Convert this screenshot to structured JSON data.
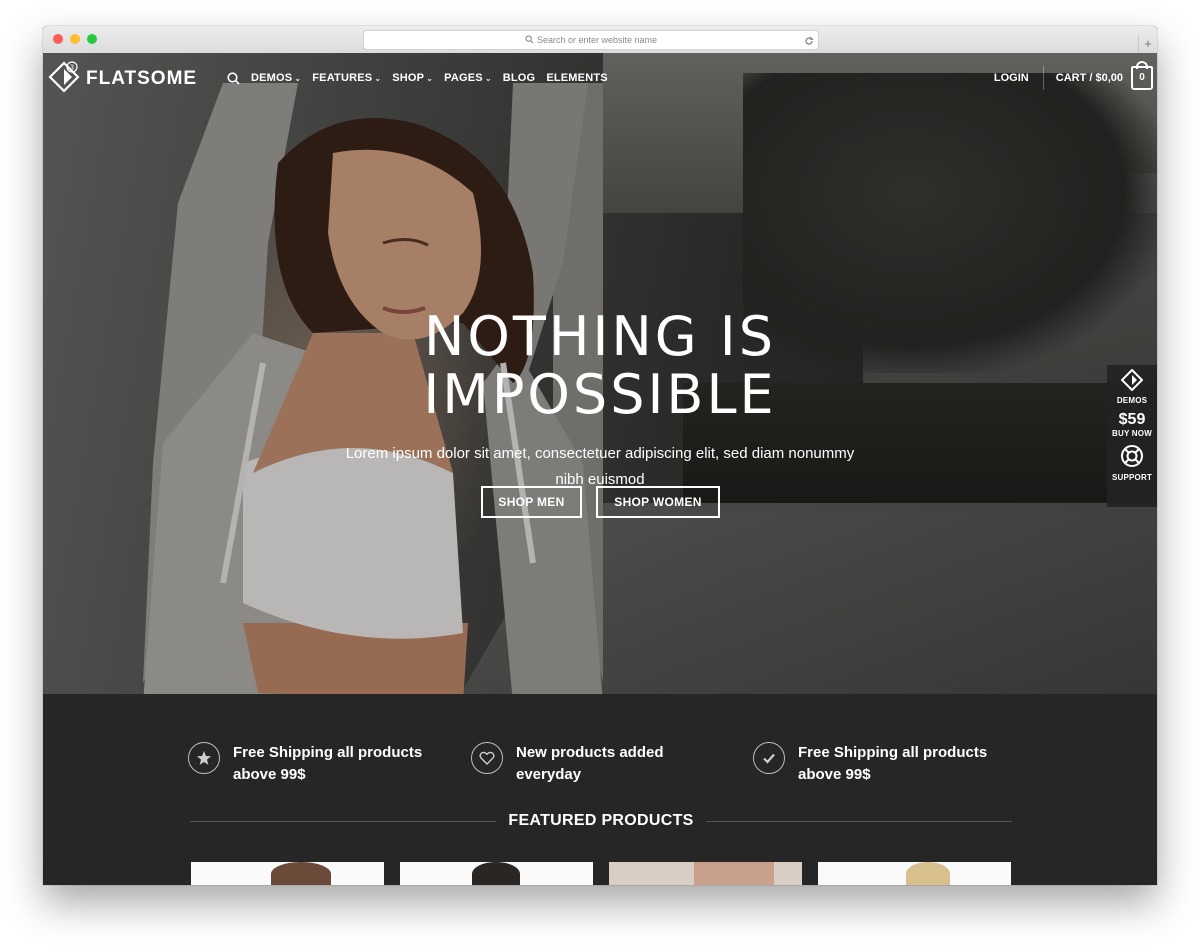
{
  "browser": {
    "url_placeholder": "Search or enter website name"
  },
  "nav": {
    "logo_text": "FLATSOME",
    "logo_badge": "3",
    "menu": [
      {
        "label": "DEMOS",
        "has_dropdown": true
      },
      {
        "label": "FEATURES",
        "has_dropdown": true
      },
      {
        "label": "SHOP",
        "has_dropdown": true
      },
      {
        "label": "PAGES",
        "has_dropdown": true
      },
      {
        "label": "BLOG",
        "has_dropdown": false
      },
      {
        "label": "ELEMENTS",
        "has_dropdown": false
      }
    ],
    "login": "LOGIN",
    "cart_label": "CART / $0,00",
    "cart_count": "0"
  },
  "hero": {
    "headline_line1": "NOTHING IS",
    "headline_line2": "IMPOSSIBLE",
    "subtext": "Lorem ipsum dolor sit amet, consectetuer adipiscing elit, sed diam nonummy nibh euismod",
    "button_men": "SHOP MEN",
    "button_women": "SHOP WOMEN",
    "slides_total": 3,
    "active_slide": 1
  },
  "side_panel": {
    "demos_label": "DEMOS",
    "price": "$59",
    "buy_label": "BUY NOW",
    "support_label": "SUPPORT"
  },
  "features": [
    {
      "icon": "star-icon",
      "text": "Free Shipping all products above 99$"
    },
    {
      "icon": "heart-icon",
      "text": "New products added everyday"
    },
    {
      "icon": "check-icon",
      "text": "Free Shipping all products above 99$"
    }
  ],
  "featured_title": "FEATURED PRODUCTS",
  "colors": {
    "dark_section": "#262626",
    "text": "#ffffff"
  }
}
